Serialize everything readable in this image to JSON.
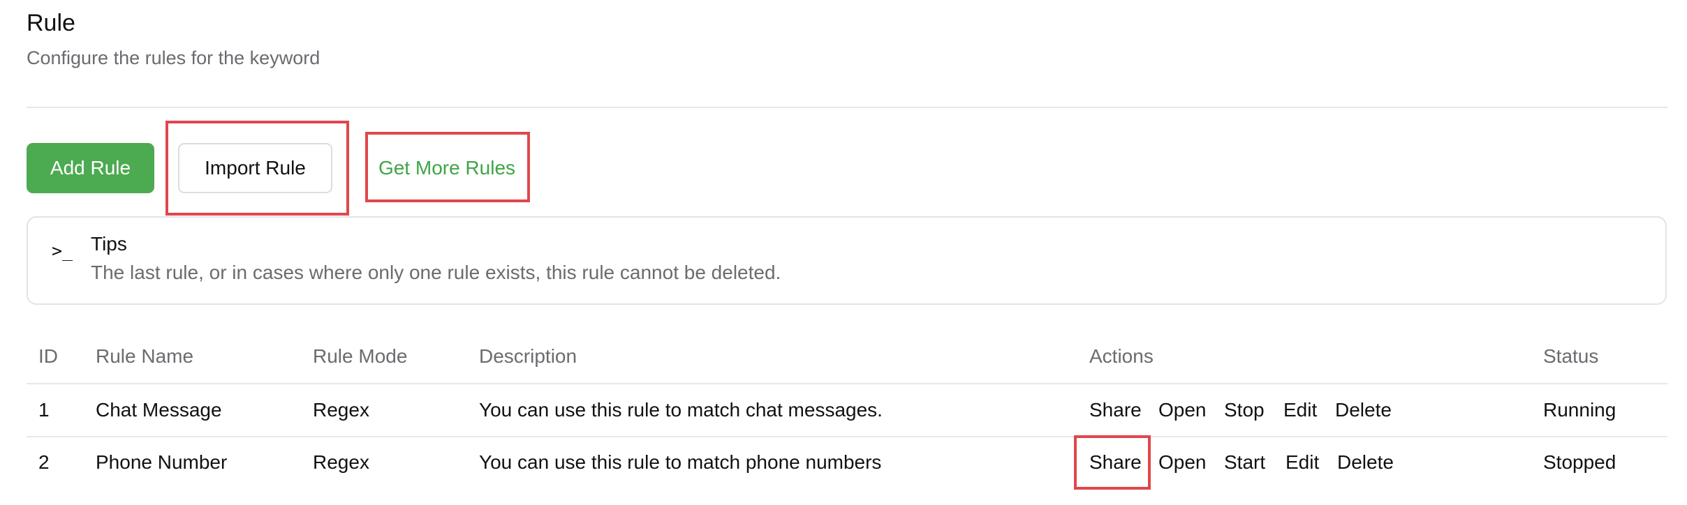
{
  "header": {
    "title": "Rule",
    "subtitle": "Configure the rules for the keyword"
  },
  "toolbar": {
    "add_label": "Add Rule",
    "import_label": "Import Rule",
    "more_label": "Get More Rules",
    "accent_color": "#4caa51"
  },
  "tips": {
    "icon": "terminal-prompt-icon",
    "title": "Tips",
    "text": "The last rule, or in cases where only one rule exists, this rule cannot be deleted."
  },
  "table": {
    "columns": [
      "ID",
      "Rule Name",
      "Rule Mode",
      "Description",
      "Actions",
      "Status"
    ],
    "rows": [
      {
        "id": "1",
        "name": "Chat Message",
        "mode": "Regex",
        "description": "You can use this rule to match chat messages.",
        "actions": [
          "Share",
          "Open",
          "Stop",
          "Edit",
          "Delete"
        ],
        "status": "Running"
      },
      {
        "id": "2",
        "name": "Phone Number",
        "mode": "Regex",
        "description": "You can use this rule to match phone numbers",
        "actions": [
          "Share",
          "Open",
          "Start",
          "Edit",
          "Delete"
        ],
        "status": "Stopped"
      }
    ]
  },
  "highlight_color": "#e0474c"
}
